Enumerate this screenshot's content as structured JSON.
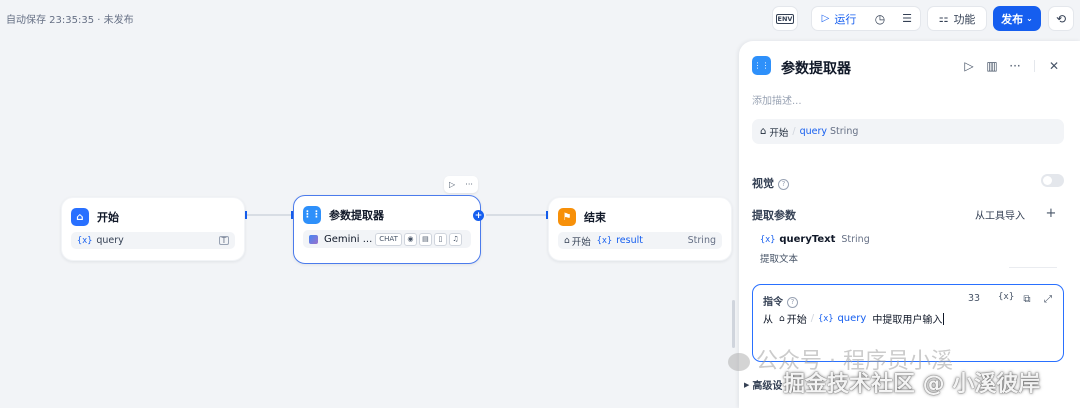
{
  "status": {
    "autosave": "自动保存 23:35:35 · 未发布"
  },
  "toolbar": {
    "env_label": "ENV",
    "run_label": "运行",
    "features_label": "功能",
    "publish_label": "发布"
  },
  "canvas": {
    "start_node": {
      "title": "开始",
      "var_prefix": "{x}",
      "var_name": "query"
    },
    "extractor_node": {
      "title": "参数提取器",
      "model": "Gemini ...",
      "tag": "CHAT"
    },
    "end_node": {
      "title": "结束",
      "source": "开始",
      "var_prefix": "{x}",
      "var_name": "result",
      "type": "String"
    }
  },
  "panel": {
    "title": "参数提取器",
    "description_placeholder": "添加描述...",
    "input_var": {
      "source": "开始",
      "name": "query",
      "type": "String"
    },
    "vision_label": "视觉",
    "extract_params_label": "提取参数",
    "import_from_tool": "从工具导入",
    "param": {
      "prefix": "{x}",
      "name": "queryText",
      "type": "String",
      "description": "提取文本"
    },
    "instruction": {
      "label": "指令",
      "count": "33",
      "var_button": "{x}",
      "prefix": "从",
      "source": "开始",
      "var_prefix": "{x}",
      "var_name": "query",
      "suffix": "中提取用户输入"
    },
    "advanced_label": "高级设"
  },
  "watermark": {
    "faint": "公众号 · 程序员小溪",
    "main": "掘金技术社区 @ 小溪彼岸"
  }
}
